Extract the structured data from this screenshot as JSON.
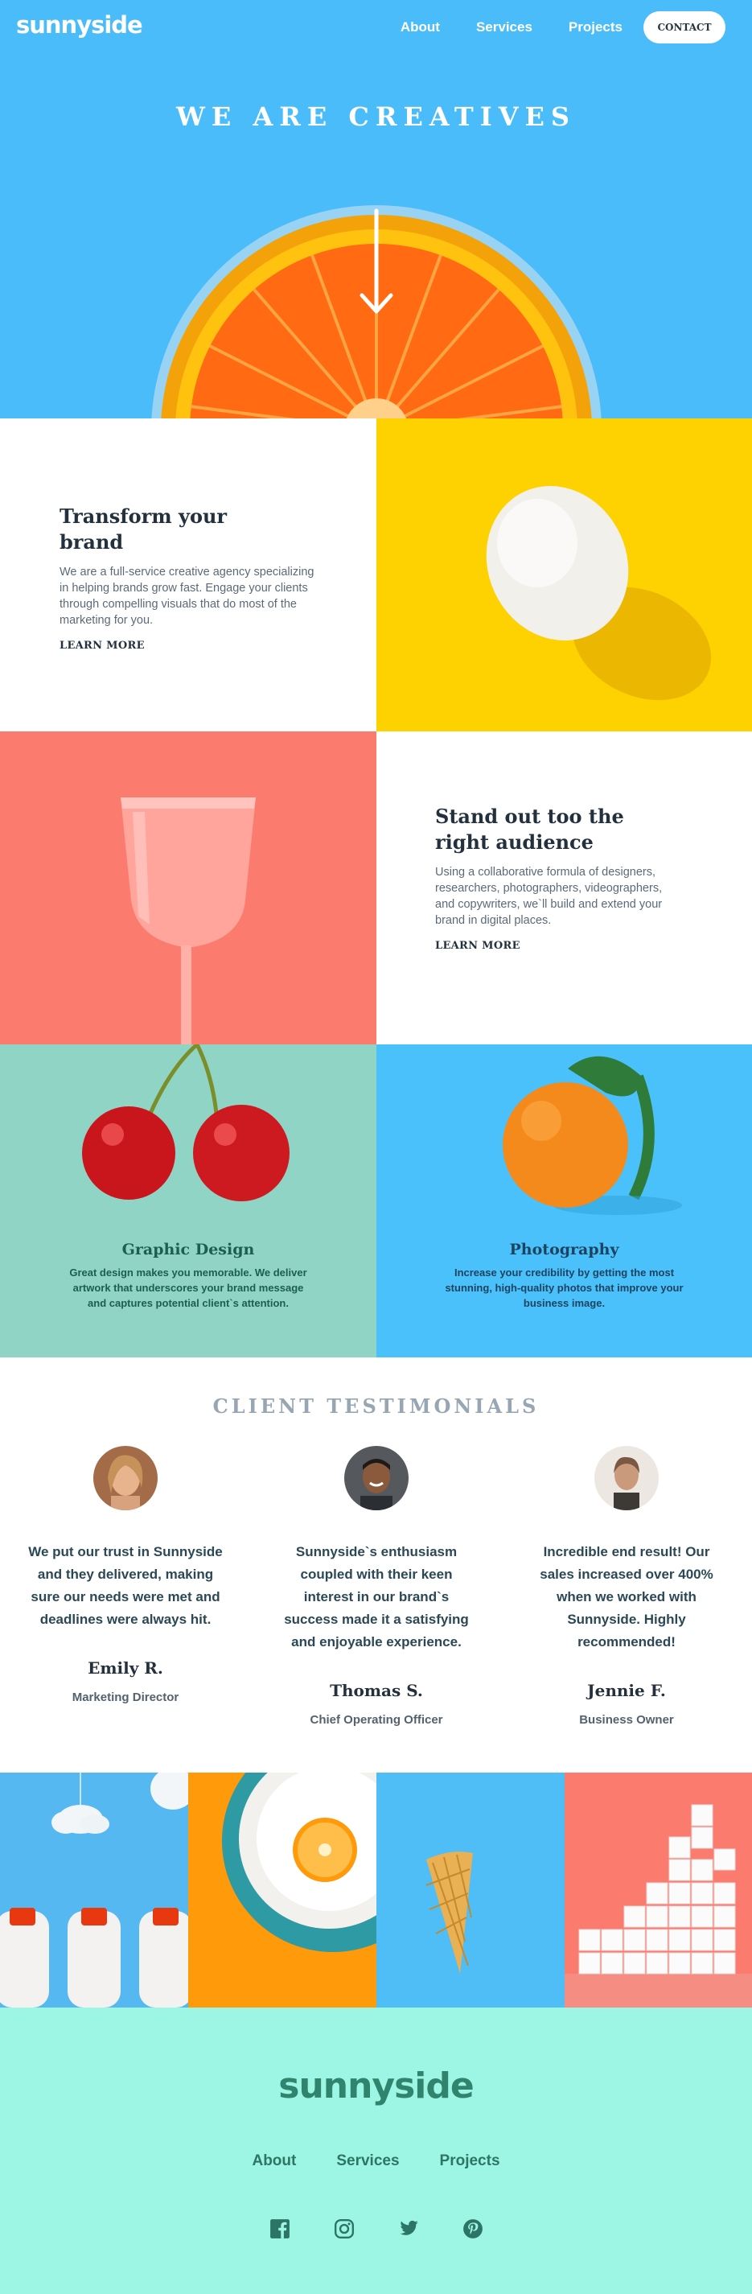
{
  "header": {
    "logo": "sunnyside",
    "nav": [
      "About",
      "Services",
      "Projects"
    ],
    "contact_label": "CONTACT"
  },
  "hero": {
    "title": "WE ARE CREATIVES"
  },
  "features": [
    {
      "title_line1": "Transform your",
      "title_line2": "brand",
      "body": "We are a full-service creative agency specializing in helping brands grow fast. Engage your clients through compelling visuals that do most of the marketing for you.",
      "link": "LEARN MORE",
      "underline_color": "#fae2a1"
    },
    {
      "title_line1": "Stand out too the",
      "title_line2": "right audience",
      "body": "Using a collaborative formula of designers, researchers, photographers, videographers, and copywriters, we`ll build and extend your brand in digital places.",
      "link": "LEARN MORE",
      "underline_color": "#f9c5be"
    }
  ],
  "services": [
    {
      "title": "Graphic Design",
      "body": "Great design makes you memorable. We deliver artwork that underscores your brand message and captures potential client`s attention.",
      "text_color": "#1d5f4e"
    },
    {
      "title": "Photography",
      "body": "Increase your credibility by getting the most stunning, high-quality photos that improve your business image.",
      "text_color": "#1c4360"
    }
  ],
  "testimonials": {
    "heading": "CLIENT TESTIMONIALS",
    "items": [
      {
        "quote": "We put our trust in Sunnyside and they delivered, making sure our needs were met and deadlines were always hit.",
        "name": "Emily R.",
        "role": "Marketing Director"
      },
      {
        "quote": "Sunnyside`s enthusiasm coupled with their keen interest in our brand`s success made it a satisfying and enjoyable experience.",
        "name": "Thomas S.",
        "role": "Chief Operating Officer"
      },
      {
        "quote": "Incredible end result! Our sales increased over 400% when we worked with Sunnyside. Highly recommended!",
        "name": "Jennie F.",
        "role": "Business Owner"
      }
    ]
  },
  "footer": {
    "logo": "sunnyside",
    "nav": [
      "About",
      "Services",
      "Projects"
    ],
    "social_icons": [
      "facebook-icon",
      "instagram-icon",
      "twitter-icon",
      "pinterest-icon"
    ]
  },
  "colors": {
    "hero_blue": "#4abcfa",
    "yellow": "#fed100",
    "coral": "#fb7c6e",
    "mint": "#90d4c5",
    "footer_mint": "#9df6e4",
    "footer_text": "#2e7564"
  }
}
